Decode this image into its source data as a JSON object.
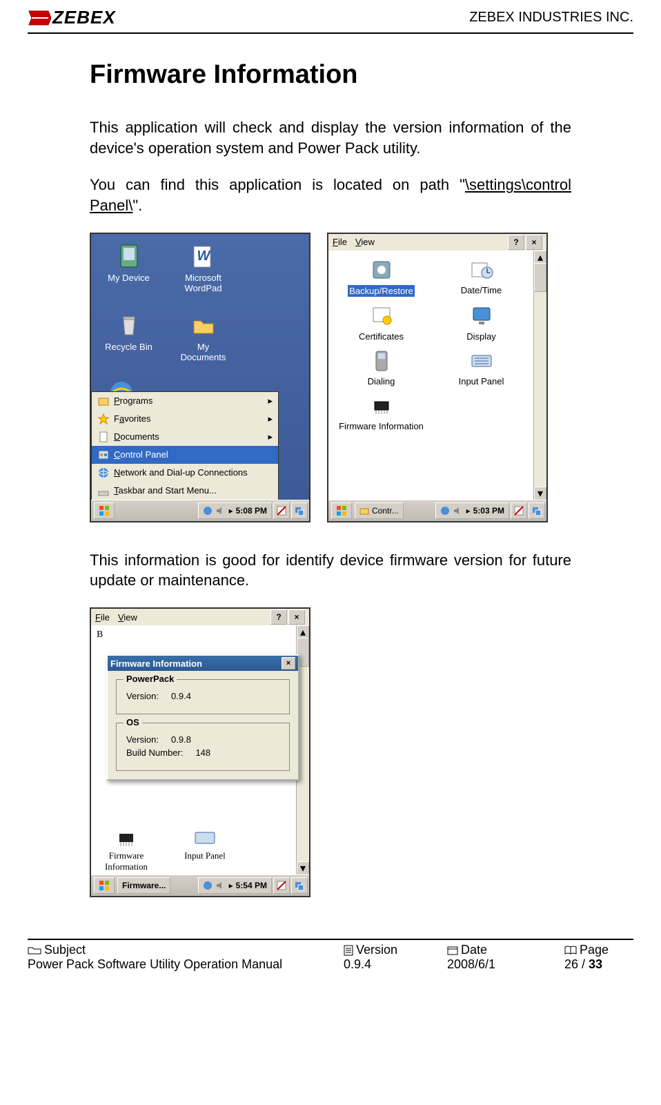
{
  "header": {
    "logo_text": "ZEBEX",
    "company": "ZEBEX INDUSTRIES INC."
  },
  "title": "Firmware Information",
  "paragraphs": {
    "p1": "This application will check  and display the version information of the device's operation system and Power Pack utility.",
    "p2_pre": "You can find this application is located on path \"",
    "p2_link": "\\settings\\control Panel\\",
    "p2_post": "\".",
    "p3": "This information is good for identify device firmware version for future update or maintenance."
  },
  "screenshot1": {
    "icons": {
      "my_device": "My Device",
      "wordpad": "Microsoft WordPad",
      "recycle": "Recycle Bin",
      "docs": "My Documents"
    },
    "menu": {
      "programs": "Programs",
      "favorites": "Favorites",
      "documents": "Documents",
      "control_panel": "Control Panel",
      "network": "Network and Dial-up Connections",
      "taskbar": "Taskbar and Start Menu..."
    },
    "taskbar": {
      "time": "5:08 PM"
    }
  },
  "screenshot2": {
    "menu": {
      "file": "File",
      "view": "View",
      "help": "?",
      "close": "×"
    },
    "items": {
      "backup": "Backup/Restore",
      "datetime": "Date/Time",
      "certs": "Certificates",
      "display": "Display",
      "dialing": "Dialing",
      "input_panel": "Input Panel",
      "firmware": "Firmware Information"
    },
    "taskbar": {
      "label": "Contr...",
      "time": "5:03 PM"
    }
  },
  "screenshot3": {
    "menu": {
      "file": "File",
      "view": "View",
      "help": "?",
      "close": "×"
    },
    "dialog": {
      "title": "Firmware Information",
      "group1": "PowerPack",
      "g1_version_label": "Version:",
      "g1_version_val": "0.9.4",
      "group2": "OS",
      "g2_version_label": "Version:",
      "g2_version_val": "0.9.8",
      "g2_build_label": "Build Number:",
      "g2_build_val": "148"
    },
    "bg_items": {
      "firmware": "Firmware Information",
      "input_panel": "Input Panel"
    },
    "taskbar": {
      "label": "Firmware...",
      "time": "5:54 PM"
    }
  },
  "footer": {
    "subject_label": "Subject",
    "subject_val": "Power Pack Software Utility Operation Manual",
    "version_label": "Version",
    "version_val": "0.9.4",
    "date_label": "Date",
    "date_val": "2008/6/1",
    "page_label": "Page",
    "page_val_pre": "26 / ",
    "page_val_bold": "33"
  }
}
